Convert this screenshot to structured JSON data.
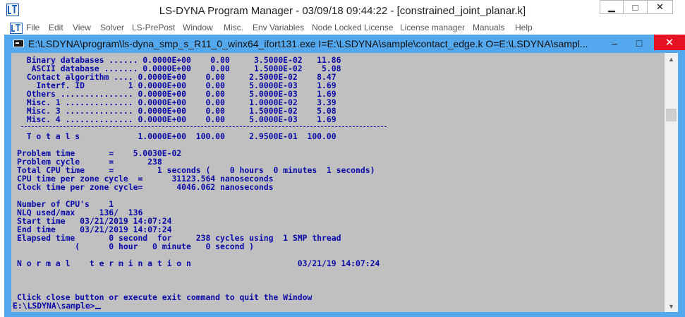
{
  "app": {
    "title": "LS-DYNA Program Manager - 03/09/18 09:44:22 - [constrained_joint_planar.k]",
    "logo": "lstc-logo",
    "buttons": {
      "minimize": "▁",
      "maximize": "□",
      "close": "✕"
    }
  },
  "menu": {
    "items": [
      "File",
      "Edit",
      "View",
      "Solver",
      "LS-PrePost",
      "Window",
      "Misc.",
      "Env Variables",
      "Node Locked License",
      "License manager",
      "Manuals",
      "Help"
    ]
  },
  "console": {
    "title": "E:\\LSDYNA\\program\\ls-dyna_smp_s_R11_0_winx64_ifort131.exe  I=E:\\LSDYNA\\sample\\contact_edge.k O=E:\\LSDYNA\\sampl...",
    "buttons": {
      "minimize": "–",
      "maximize": "□",
      "close": "✕"
    },
    "text": "  Binary databases ...... 0.0000E+00    0.00     3.5000E-02   11.86\n   ASCII database ....... 0.0000E+00    0.00     1.5000E-02    5.08\n  Contact algorithm .... 0.0000E+00    0.00     2.5000E-02    8.47\n    Interf. ID         1 0.0000E+00    0.00     5.0000E-03    1.69\n  Others ............... 0.0000E+00    0.00     5.0000E-03    1.69\n  Misc. 1 .............. 0.0000E+00    0.00     1.0000E-02    3.39\n  Misc. 3 .............. 0.0000E+00    0.00     1.5000E-02    5.08\n  Misc. 4 .............. 0.0000E+00    0.00     5.0000E-03    1.69\n\n  T o t a l s            1.0000E+00  100.00     2.9500E-01  100.00\n\nProblem time       =    5.0030E-02\nProblem cycle      =       238\nTotal CPU time     =         1 seconds (    0 hours  0 minutes  1 seconds)\nCPU time per zone cycle  =      31123.564 nanoseconds\nClock time per zone cycle=       4046.062 nanoseconds\n\nNumber of CPU's    1\nNLQ used/max     136/  136\nStart time   03/21/2019 14:07:24\nEnd time     03/21/2019 14:07:24\nElapsed time       0 second  for     238 cycles using  1 SMP thread\n            (      0 hour   0 minute   0 second )\n\nN o r m a l    t e r m i n a t i o n                      03/21/19 14:07:24\n\n\n\nClick close button or execute exit command to quit the Window",
    "prompt": "E:\\LSDYNA\\sample>"
  },
  "scrollbar": {
    "up": "▲",
    "down": "▼"
  }
}
